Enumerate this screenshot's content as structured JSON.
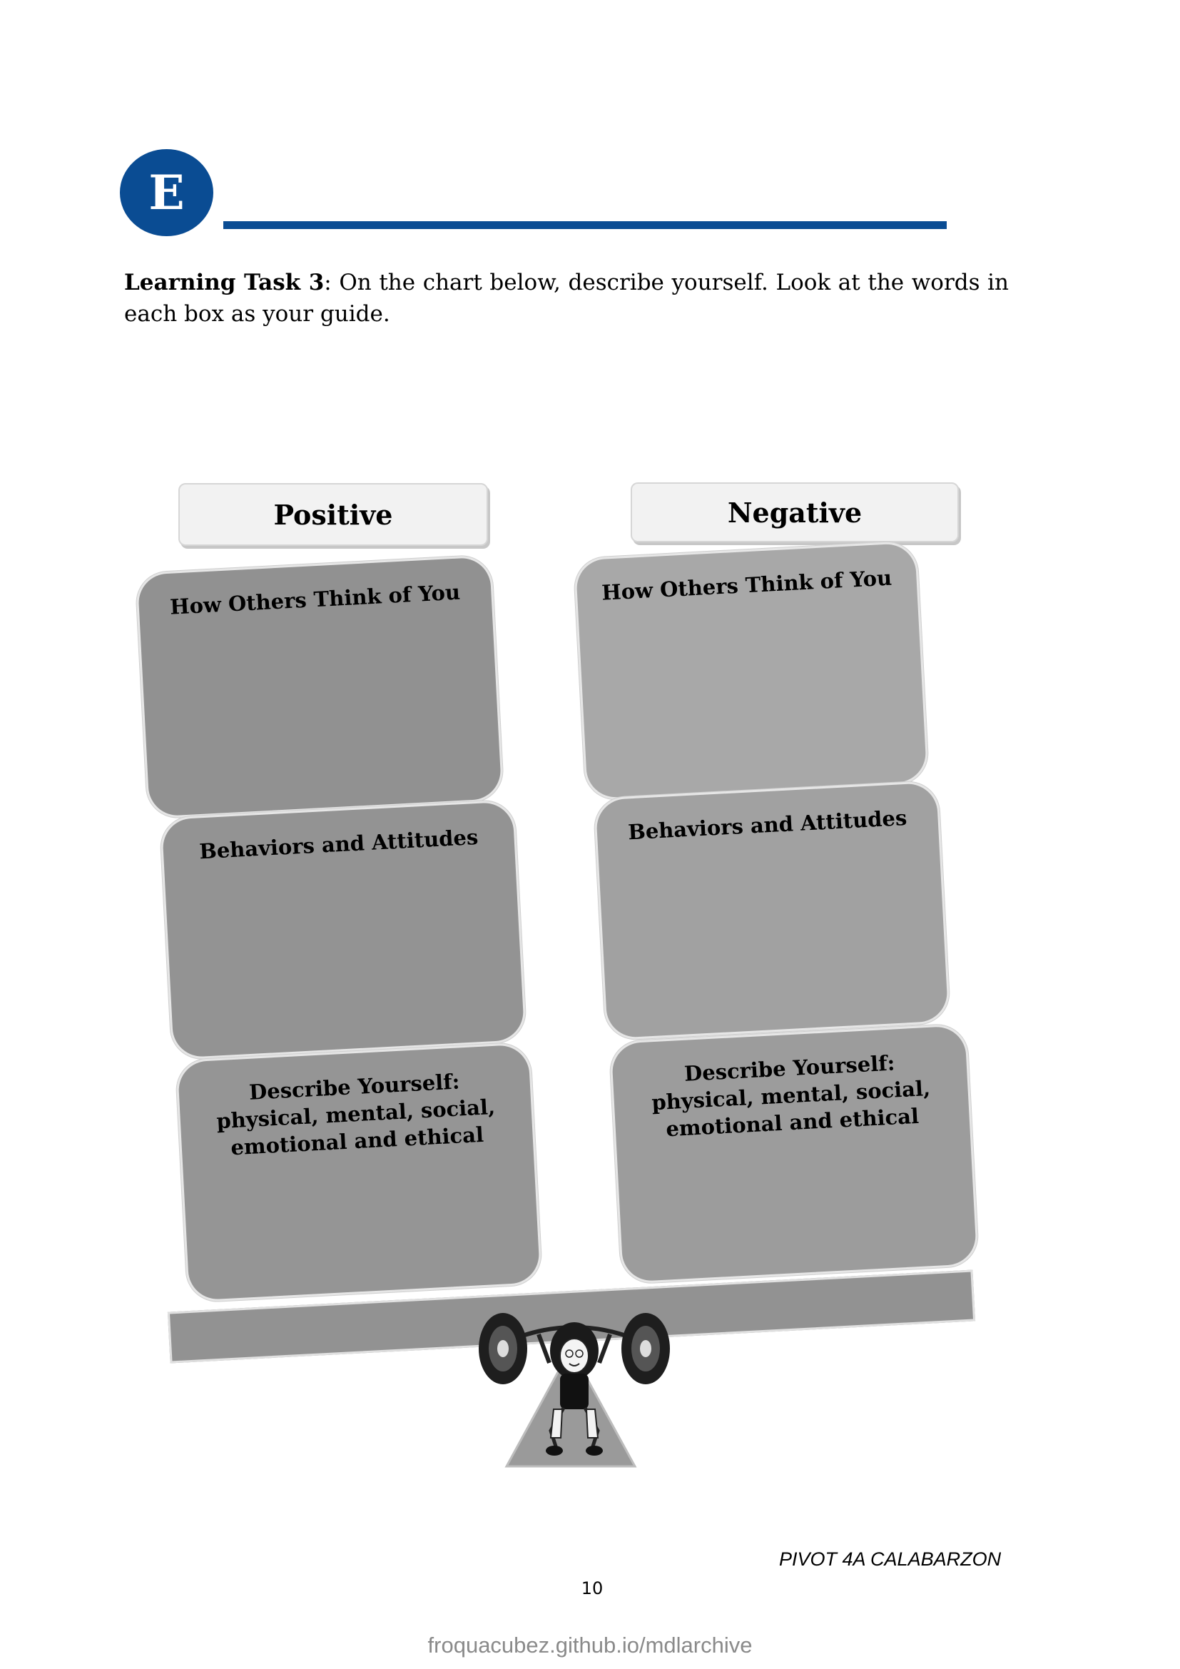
{
  "header": {
    "badge_letter": "E",
    "accent_color": "#0a4c93"
  },
  "instructions": {
    "bold_lead": "Learning Task 3",
    "text": ": On the chart below, describe yourself. Look at the words in each box as your guide."
  },
  "chart": {
    "positive": {
      "title": "Positive",
      "boxes": [
        "How Others Think of You",
        "Behaviors and Attitudes",
        "Describe Yourself: physical, mental, social, emotional and ethical"
      ]
    },
    "negative": {
      "title": "Negative",
      "boxes": [
        "How Others Think of You",
        "Behaviors and Attitudes",
        "Describe Yourself: physical, mental, social, emotional and ethical"
      ]
    },
    "illustration": "weightlifter-balancing-beam"
  },
  "footer": {
    "brand": "PIVOT 4A CALABARZON",
    "page_number": "10",
    "watermark": "froquacubez.github.io/mdlarchive"
  }
}
